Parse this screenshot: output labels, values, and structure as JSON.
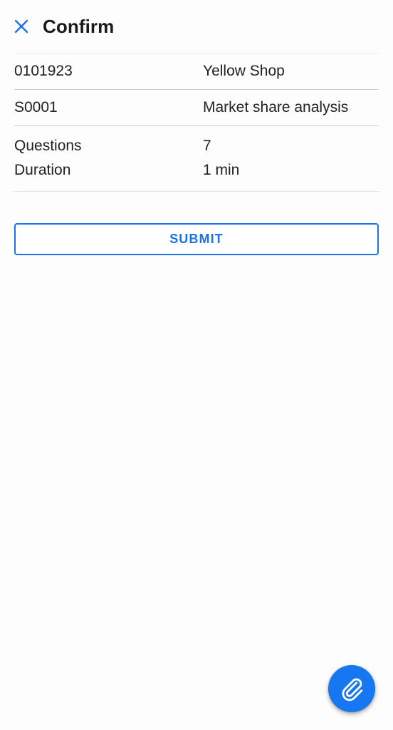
{
  "header": {
    "title": "Confirm",
    "close_icon": "close-icon"
  },
  "details": {
    "rows": [
      {
        "label": "0101923",
        "value": "Yellow Shop"
      },
      {
        "label": "S0001",
        "value": "Market share analysis"
      }
    ],
    "summary": [
      {
        "label": "Questions",
        "value": "7"
      },
      {
        "label": "Duration",
        "value": "1 min"
      }
    ]
  },
  "actions": {
    "submit_label": "SUBMIT",
    "attach_icon": "paperclip-icon"
  },
  "colors": {
    "accent": "#1a73e8",
    "fab": "#1677f0",
    "text": "#212121",
    "divider": "#cfcfcf",
    "background": "#fdfdfd"
  }
}
